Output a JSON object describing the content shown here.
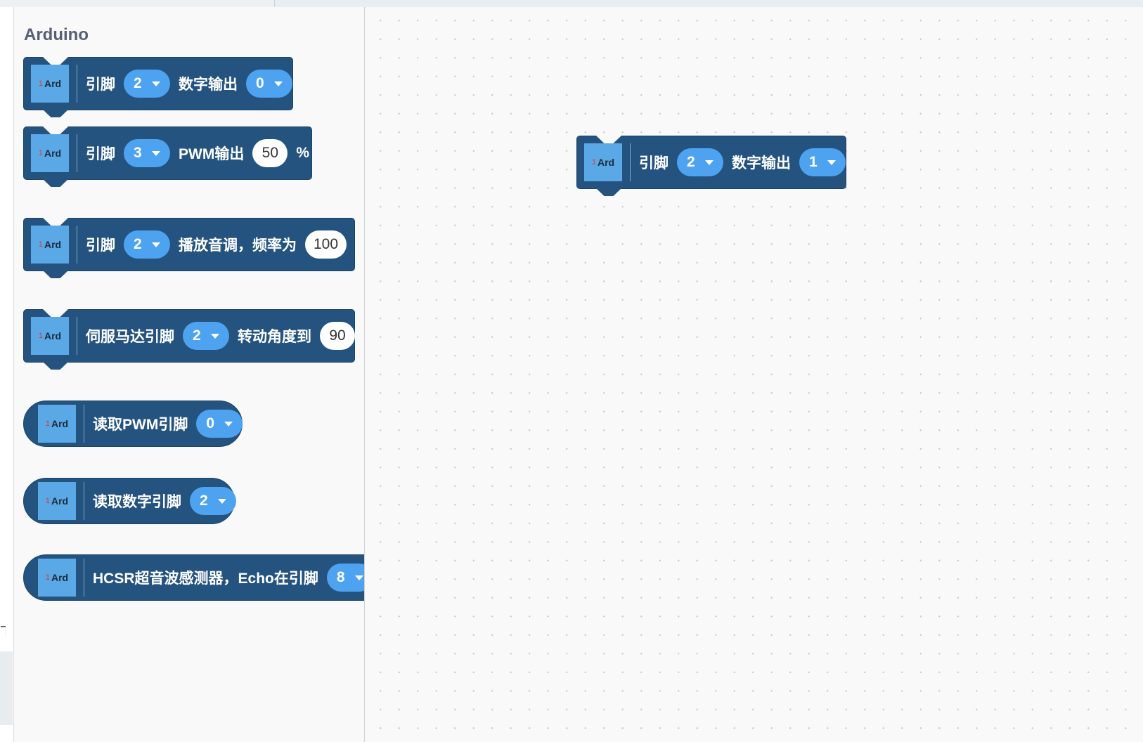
{
  "category": {
    "title": "Arduino"
  },
  "ard_icon": {
    "number": "1",
    "text": "Ard"
  },
  "blocks": {
    "digital_write": {
      "label_pin": "引脚",
      "pin": "2",
      "label_action": "数字输出",
      "value": "0"
    },
    "pwm_write": {
      "label_pin": "引脚",
      "pin": "3",
      "label_action": "PWM输出",
      "value": "50",
      "unit": "%"
    },
    "tone": {
      "label_pin": "引脚",
      "pin": "2",
      "label_action": "播放音调，频率为",
      "value": "100"
    },
    "servo": {
      "label_action": "伺服马达引脚",
      "pin": "2",
      "label_angle": "转动角度到",
      "value": "90"
    },
    "read_pwm": {
      "label_action": "读取PWM引脚",
      "pin": "0"
    },
    "read_digital": {
      "label_action": "读取数字引脚",
      "pin": "2"
    },
    "ultrasonic": {
      "label_action": "HCSR超音波感测器，Echo在引脚",
      "pin": "8"
    }
  },
  "workspace": {
    "digital_write": {
      "label_pin": "引脚",
      "pin": "2",
      "label_action": "数字输出",
      "value": "1"
    }
  },
  "colors": {
    "block": "#24537f",
    "dropdown": "#4ea3f0",
    "ard_icon": "#5aa9e6",
    "category_title": "#575e75"
  }
}
